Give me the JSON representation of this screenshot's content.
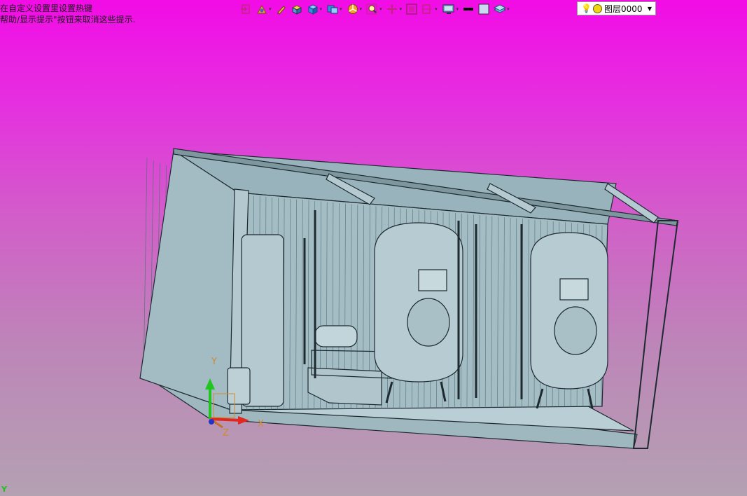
{
  "hints": {
    "line1": "在自定义设置里设置热键",
    "line2": "帮助/显示提示\"按钮来取消这些提示."
  },
  "toolbar": {
    "icons": [
      "select-icon",
      "snap-icon",
      "pen-icon",
      "box-icon",
      "cube-view-icon",
      "view-cube-icon",
      "render-icon",
      "zoom-icon",
      "pan-icon",
      "fit-icon",
      "section-icon",
      "display-icon",
      "line-color-icon",
      "fill-color-icon",
      "layer-tool-icon"
    ],
    "layer": {
      "name": "图层0000"
    }
  },
  "axes": {
    "x": "X",
    "y": "Y",
    "z": "Z"
  },
  "corner_label": "Y",
  "colors": {
    "model": "#a9c2ca",
    "edge": "#1d2a30",
    "shade": "#8aa5ae",
    "light": "#c7d9de"
  }
}
